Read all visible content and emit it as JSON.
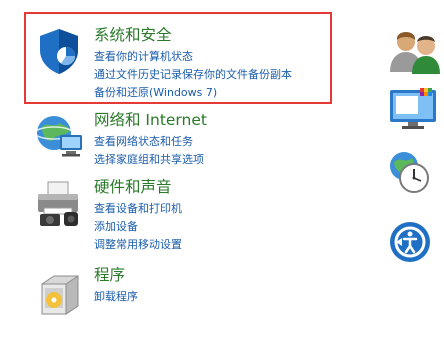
{
  "categories": [
    {
      "title": "系统和安全",
      "links": [
        "查看你的计算机状态",
        "通过文件历史记录保存你的文件备份副本",
        "备份和还原(Windows 7)"
      ],
      "highlighted": true,
      "icon": "shield-icon"
    },
    {
      "title": "网络和 Internet",
      "links": [
        "查看网络状态和任务",
        "选择家庭组和共享选项"
      ],
      "icon": "network-globe-icon"
    },
    {
      "title": "硬件和声音",
      "links": [
        "查看设备和打印机",
        "添加设备",
        "调整常用移动设置"
      ],
      "icon": "printer-icon"
    },
    {
      "title": "程序",
      "links": [
        "卸载程序"
      ],
      "icon": "programs-box-icon"
    }
  ],
  "right_icons": [
    "user-accounts-icon",
    "appearance-icon",
    "clock-region-icon",
    "ease-of-access-icon"
  ],
  "colors": {
    "highlight_border": "#e53935",
    "title_green": "#2a7a2a",
    "link_blue": "#1a5dab"
  }
}
